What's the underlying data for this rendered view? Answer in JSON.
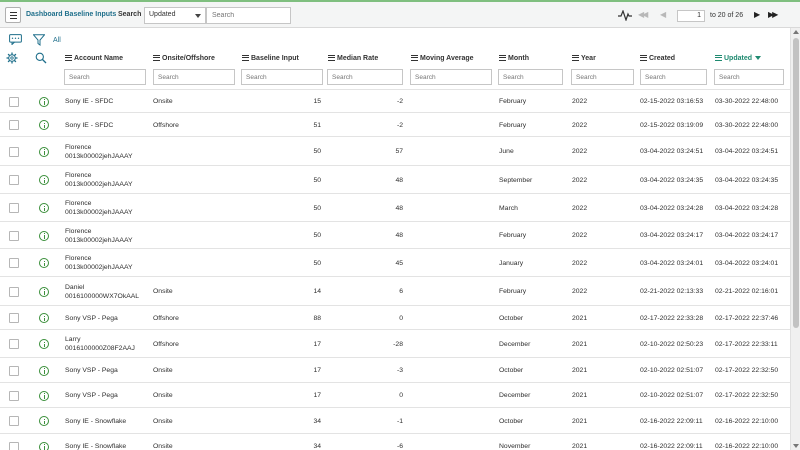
{
  "toolbar": {
    "list_title": "Dashboard Baseline Inputs",
    "search_label": "Search",
    "search_field": "Updated",
    "search_placeholder": "Search",
    "page_current": "1",
    "page_range_text": "to 20 of 26"
  },
  "filter": {
    "all_link": "All"
  },
  "columns": [
    {
      "key": "account",
      "label": "Account Name"
    },
    {
      "key": "onsite",
      "label": "Onsite/Offshore"
    },
    {
      "key": "baseline",
      "label": "Baseline Input"
    },
    {
      "key": "median",
      "label": "Median Rate"
    },
    {
      "key": "moving",
      "label": "Moving Average"
    },
    {
      "key": "month",
      "label": "Month"
    },
    {
      "key": "year",
      "label": "Year"
    },
    {
      "key": "created",
      "label": "Created"
    },
    {
      "key": "updated",
      "label": "Updated",
      "sorted": "desc"
    }
  ],
  "column_search_placeholder": "Search",
  "rows": [
    {
      "account": "Sony IE - SFDC",
      "account2": "",
      "onsite": "Onsite",
      "baseline": "15",
      "median": "-2",
      "moving": "",
      "month": "February",
      "year": "2022",
      "created": "02-15-2022 03:16:53",
      "updated": "03-30-2022 22:48:00"
    },
    {
      "account": "Sony IE - SFDC",
      "account2": "",
      "onsite": "Offshore",
      "baseline": "51",
      "median": "-2",
      "moving": "",
      "month": "February",
      "year": "2022",
      "created": "02-15-2022 03:19:09",
      "updated": "03-30-2022 22:48:00"
    },
    {
      "account": "Florence",
      "account2": "0013k00002jehJAAAY",
      "onsite": "",
      "baseline": "50",
      "median": "57",
      "moving": "",
      "month": "June",
      "year": "2022",
      "created": "03-04-2022 03:24:51",
      "updated": "03-04-2022 03:24:51"
    },
    {
      "account": "Florence",
      "account2": "0013k00002jehJAAAY",
      "onsite": "",
      "baseline": "50",
      "median": "48",
      "moving": "",
      "month": "September",
      "year": "2022",
      "created": "03-04-2022 03:24:35",
      "updated": "03-04-2022 03:24:35"
    },
    {
      "account": "Florence",
      "account2": "0013k00002jehJAAAY",
      "onsite": "",
      "baseline": "50",
      "median": "48",
      "moving": "",
      "month": "March",
      "year": "2022",
      "created": "03-04-2022 03:24:28",
      "updated": "03-04-2022 03:24:28"
    },
    {
      "account": "Florence",
      "account2": "0013k00002jehJAAAY",
      "onsite": "",
      "baseline": "50",
      "median": "48",
      "moving": "",
      "month": "February",
      "year": "2022",
      "created": "03-04-2022 03:24:17",
      "updated": "03-04-2022 03:24:17"
    },
    {
      "account": "Florence",
      "account2": "0013k00002jehJAAAY",
      "onsite": "",
      "baseline": "50",
      "median": "45",
      "moving": "",
      "month": "January",
      "year": "2022",
      "created": "03-04-2022 03:24:01",
      "updated": "03-04-2022 03:24:01"
    },
    {
      "account": "Daniel",
      "account2": "0016100000WX7OkAAL",
      "onsite": "Onsite",
      "baseline": "14",
      "median": "6",
      "moving": "",
      "month": "February",
      "year": "2022",
      "created": "02-21-2022 02:13:33",
      "updated": "02-21-2022 02:16:01"
    },
    {
      "account": "Sony VSP - Pega",
      "account2": "",
      "onsite": "Offshore",
      "baseline": "88",
      "median": "0",
      "moving": "",
      "month": "October",
      "year": "2021",
      "created": "02-17-2022 22:33:28",
      "updated": "02-17-2022 22:37:46"
    },
    {
      "account": "Larry",
      "account2": "0016100000Z08F2AAJ",
      "onsite": "Offshore",
      "baseline": "17",
      "median": "-28",
      "moving": "",
      "month": "December",
      "year": "2021",
      "created": "02-10-2022 02:50:23",
      "updated": "02-17-2022 22:33:11"
    },
    {
      "account": "Sony VSP - Pega",
      "account2": "",
      "onsite": "Onsite",
      "baseline": "17",
      "median": "-3",
      "moving": "",
      "month": "October",
      "year": "2021",
      "created": "02-10-2022 02:51:07",
      "updated": "02-17-2022 22:32:50"
    },
    {
      "account": "Sony VSP - Pega",
      "account2": "",
      "onsite": "Onsite",
      "baseline": "17",
      "median": "0",
      "moving": "",
      "month": "December",
      "year": "2021",
      "created": "02-10-2022 02:51:07",
      "updated": "02-17-2022 22:32:50"
    },
    {
      "account": "Sony IE - Snowflake",
      "account2": "",
      "onsite": "Onsite",
      "baseline": "34",
      "median": "-1",
      "moving": "",
      "month": "October",
      "year": "2021",
      "created": "02-16-2022 22:09:11",
      "updated": "02-16-2022 22:10:00"
    },
    {
      "account": "Sony IE - Snowflake",
      "account2": "",
      "onsite": "Onsite",
      "baseline": "34",
      "median": "-6",
      "moving": "",
      "month": "November",
      "year": "2021",
      "created": "02-16-2022 22:09:11",
      "updated": "02-16-2022 22:10:00"
    }
  ],
  "colors": {
    "accent": "#1f8a70",
    "link": "#1f6f8b",
    "info": "#3b8f3b",
    "top_border": "#7fbf7f"
  },
  "icons": [
    "hamburger-menu-icon",
    "activity-pulse-icon",
    "first-page-icon",
    "previous-page-icon",
    "next-page-icon",
    "last-page-icon",
    "chat-bubble-icon",
    "filter-funnel-icon",
    "settings-gear-icon",
    "search-magnifier-icon",
    "info-circle-icon"
  ]
}
